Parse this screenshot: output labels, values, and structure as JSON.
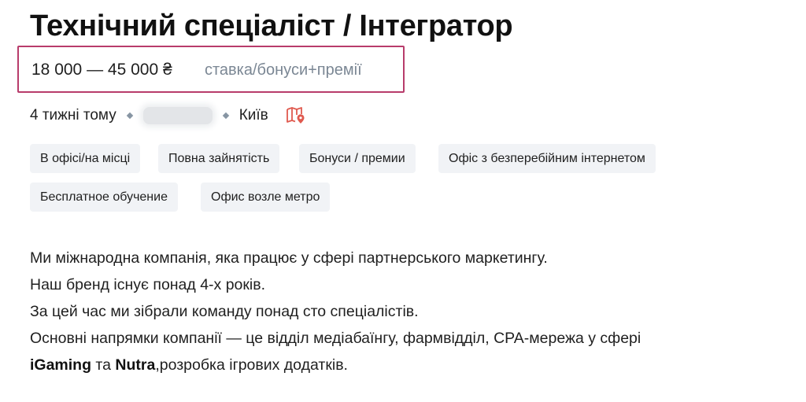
{
  "job": {
    "title": "Технічний спеціаліст / Інтегратор",
    "salary": {
      "range": "18 000 — 45 000 ₴",
      "note": "ставка/бонуси+премії"
    },
    "meta": {
      "posted": "4 тижні тому",
      "city": "Київ",
      "map_icon": "map-pin-icon"
    },
    "tags": [
      "В офісі/на місці",
      "Повна зайнятість",
      "Бонуси / премии",
      "Офіс з безперебійним інтернетом",
      "Бесплатное обучение",
      "Офис возле метро"
    ],
    "description": {
      "line1": "Ми міжнародна компанія, яка працює у сфері партнерського маркетингу.",
      "line2": "Наш бренд існує понад 4-х років.",
      "line3": "За цей час ми зібрали команду понад сто спеціалістів.",
      "line4": "Основні напрямки компанії — це відділ медіабаїнгу, фармвідділ, CPA-мережа у сфері",
      "line5_bold1": "iGaming",
      "line5_mid": " та ",
      "line5_bold2": "Nutra",
      "line5_end": ",розробка ігрових додатків."
    }
  },
  "colors": {
    "highlight_border": "#b83c6b",
    "muted_text": "#7b8794",
    "tag_bg": "#f1f3f6",
    "map_icon": "#e05a4f"
  }
}
